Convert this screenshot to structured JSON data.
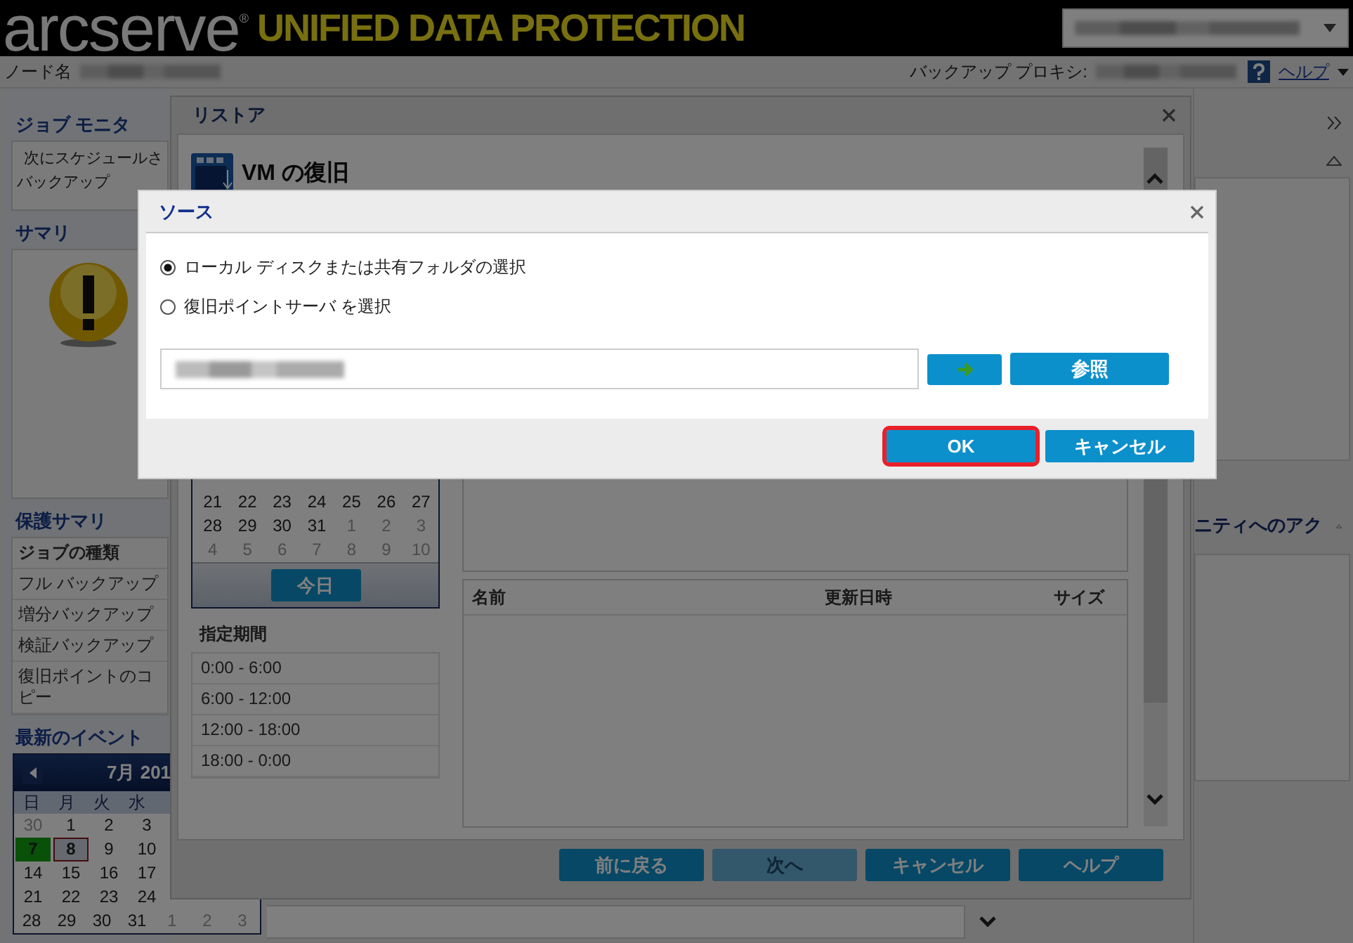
{
  "header": {
    "logo": "arcserve",
    "logo_mark": "®",
    "product": "UNIFIED DATA PROTECTION"
  },
  "topbar": {
    "node_label": "ノード名",
    "proxy_label": "バックアップ プロキシ:",
    "help_link": "ヘルプ"
  },
  "sidebar": {
    "job_monitor": {
      "title": "ジョブ モニタ",
      "lines": [
        "次にスケジュールさ",
        "バックアップ"
      ]
    },
    "summary": {
      "title": "サマリ"
    },
    "protection_summary": {
      "title": "保護サマリ",
      "header": "ジョブの種類",
      "items": [
        "フル バックアップ",
        "増分バックアップ",
        "検証バックアップ",
        "復旧ポイントのコピー"
      ]
    },
    "events": {
      "title": "最新のイベント",
      "calendar": {
        "month": "7月 201",
        "weekdays": [
          "日",
          "月",
          "火",
          "水"
        ],
        "weeks": [
          [
            {
              "day": "30",
              "outside": true,
              "today": false,
              "selected": false
            },
            {
              "day": "1",
              "outside": false,
              "today": false,
              "selected": false
            },
            {
              "day": "2",
              "outside": false,
              "today": false,
              "selected": false
            },
            {
              "day": "3",
              "outside": false,
              "today": false,
              "selected": false
            }
          ],
          [
            {
              "day": "7",
              "outside": false,
              "today": true,
              "selected": false
            },
            {
              "day": "8",
              "outside": false,
              "today": false,
              "selected": true
            },
            {
              "day": "9",
              "outside": false,
              "today": false,
              "selected": false
            },
            {
              "day": "10",
              "outside": false,
              "today": false,
              "selected": false
            }
          ],
          [
            {
              "day": "14",
              "outside": false,
              "today": false,
              "selected": false
            },
            {
              "day": "15",
              "outside": false,
              "today": false,
              "selected": false
            },
            {
              "day": "16",
              "outside": false,
              "today": false,
              "selected": false
            },
            {
              "day": "17",
              "outside": false,
              "today": false,
              "selected": false
            }
          ],
          [
            {
              "day": "21",
              "outside": false,
              "today": false,
              "selected": false
            },
            {
              "day": "22",
              "outside": false,
              "today": false,
              "selected": false
            },
            {
              "day": "23",
              "outside": false,
              "today": false,
              "selected": false
            },
            {
              "day": "24",
              "outside": false,
              "today": false,
              "selected": false
            }
          ],
          [
            {
              "day": "28",
              "outside": false,
              "today": false,
              "selected": false
            },
            {
              "day": "29",
              "outside": false,
              "today": false,
              "selected": false
            },
            {
              "day": "30",
              "outside": false,
              "today": false,
              "selected": false
            },
            {
              "day": "31",
              "outside": false,
              "today": false,
              "selected": false
            },
            {
              "day": "1",
              "outside": true,
              "today": false,
              "selected": false
            },
            {
              "day": "2",
              "outside": true,
              "today": false,
              "selected": false
            },
            {
              "day": "3",
              "outside": true,
              "today": false,
              "selected": false
            }
          ]
        ]
      }
    }
  },
  "right_panel": {
    "section_title": "ニティへのアク"
  },
  "restore_dialog": {
    "title": "リストア",
    "heading": "VM の復旧",
    "calendar": {
      "weeks": [
        [
          {
            "day": "21",
            "outside": false
          },
          {
            "day": "22",
            "outside": false
          },
          {
            "day": "23",
            "outside": false
          },
          {
            "day": "24",
            "outside": false
          },
          {
            "day": "25",
            "outside": false
          },
          {
            "day": "26",
            "outside": false
          },
          {
            "day": "27",
            "outside": false
          }
        ],
        [
          {
            "day": "28",
            "outside": false
          },
          {
            "day": "29",
            "outside": false
          },
          {
            "day": "30",
            "outside": false
          },
          {
            "day": "31",
            "outside": false
          },
          {
            "day": "1",
            "outside": true
          },
          {
            "day": "2",
            "outside": true
          },
          {
            "day": "3",
            "outside": true
          }
        ],
        [
          {
            "day": "4",
            "outside": true
          },
          {
            "day": "5",
            "outside": true
          },
          {
            "day": "6",
            "outside": true
          },
          {
            "day": "7",
            "outside": true
          },
          {
            "day": "8",
            "outside": true
          },
          {
            "day": "9",
            "outside": true
          },
          {
            "day": "10",
            "outside": true
          }
        ]
      ],
      "today_button": "今日"
    },
    "periods_title": "指定期間",
    "periods": [
      "0:00 - 6:00",
      "6:00 - 12:00",
      "12:00 - 18:00",
      "18:00 - 0:00"
    ],
    "table": {
      "columns": [
        "名前",
        "更新日時",
        "サイズ"
      ]
    },
    "buttons": [
      {
        "label": "前に戻る",
        "disabled": false
      },
      {
        "label": "次へ",
        "disabled": true
      },
      {
        "label": "キャンセル",
        "disabled": false
      },
      {
        "label": "ヘルプ",
        "disabled": false
      }
    ]
  },
  "source_dialog": {
    "title": "ソース",
    "options": [
      {
        "label": "ローカル ディスクまたは共有フォルダの選択",
        "selected": true
      },
      {
        "label": "復旧ポイントサーバ を選択",
        "selected": false
      }
    ],
    "browse_button": "参照",
    "buttons": [
      {
        "label": "OK",
        "highlighted": true
      },
      {
        "label": "キャンセル",
        "highlighted": false
      }
    ]
  }
}
